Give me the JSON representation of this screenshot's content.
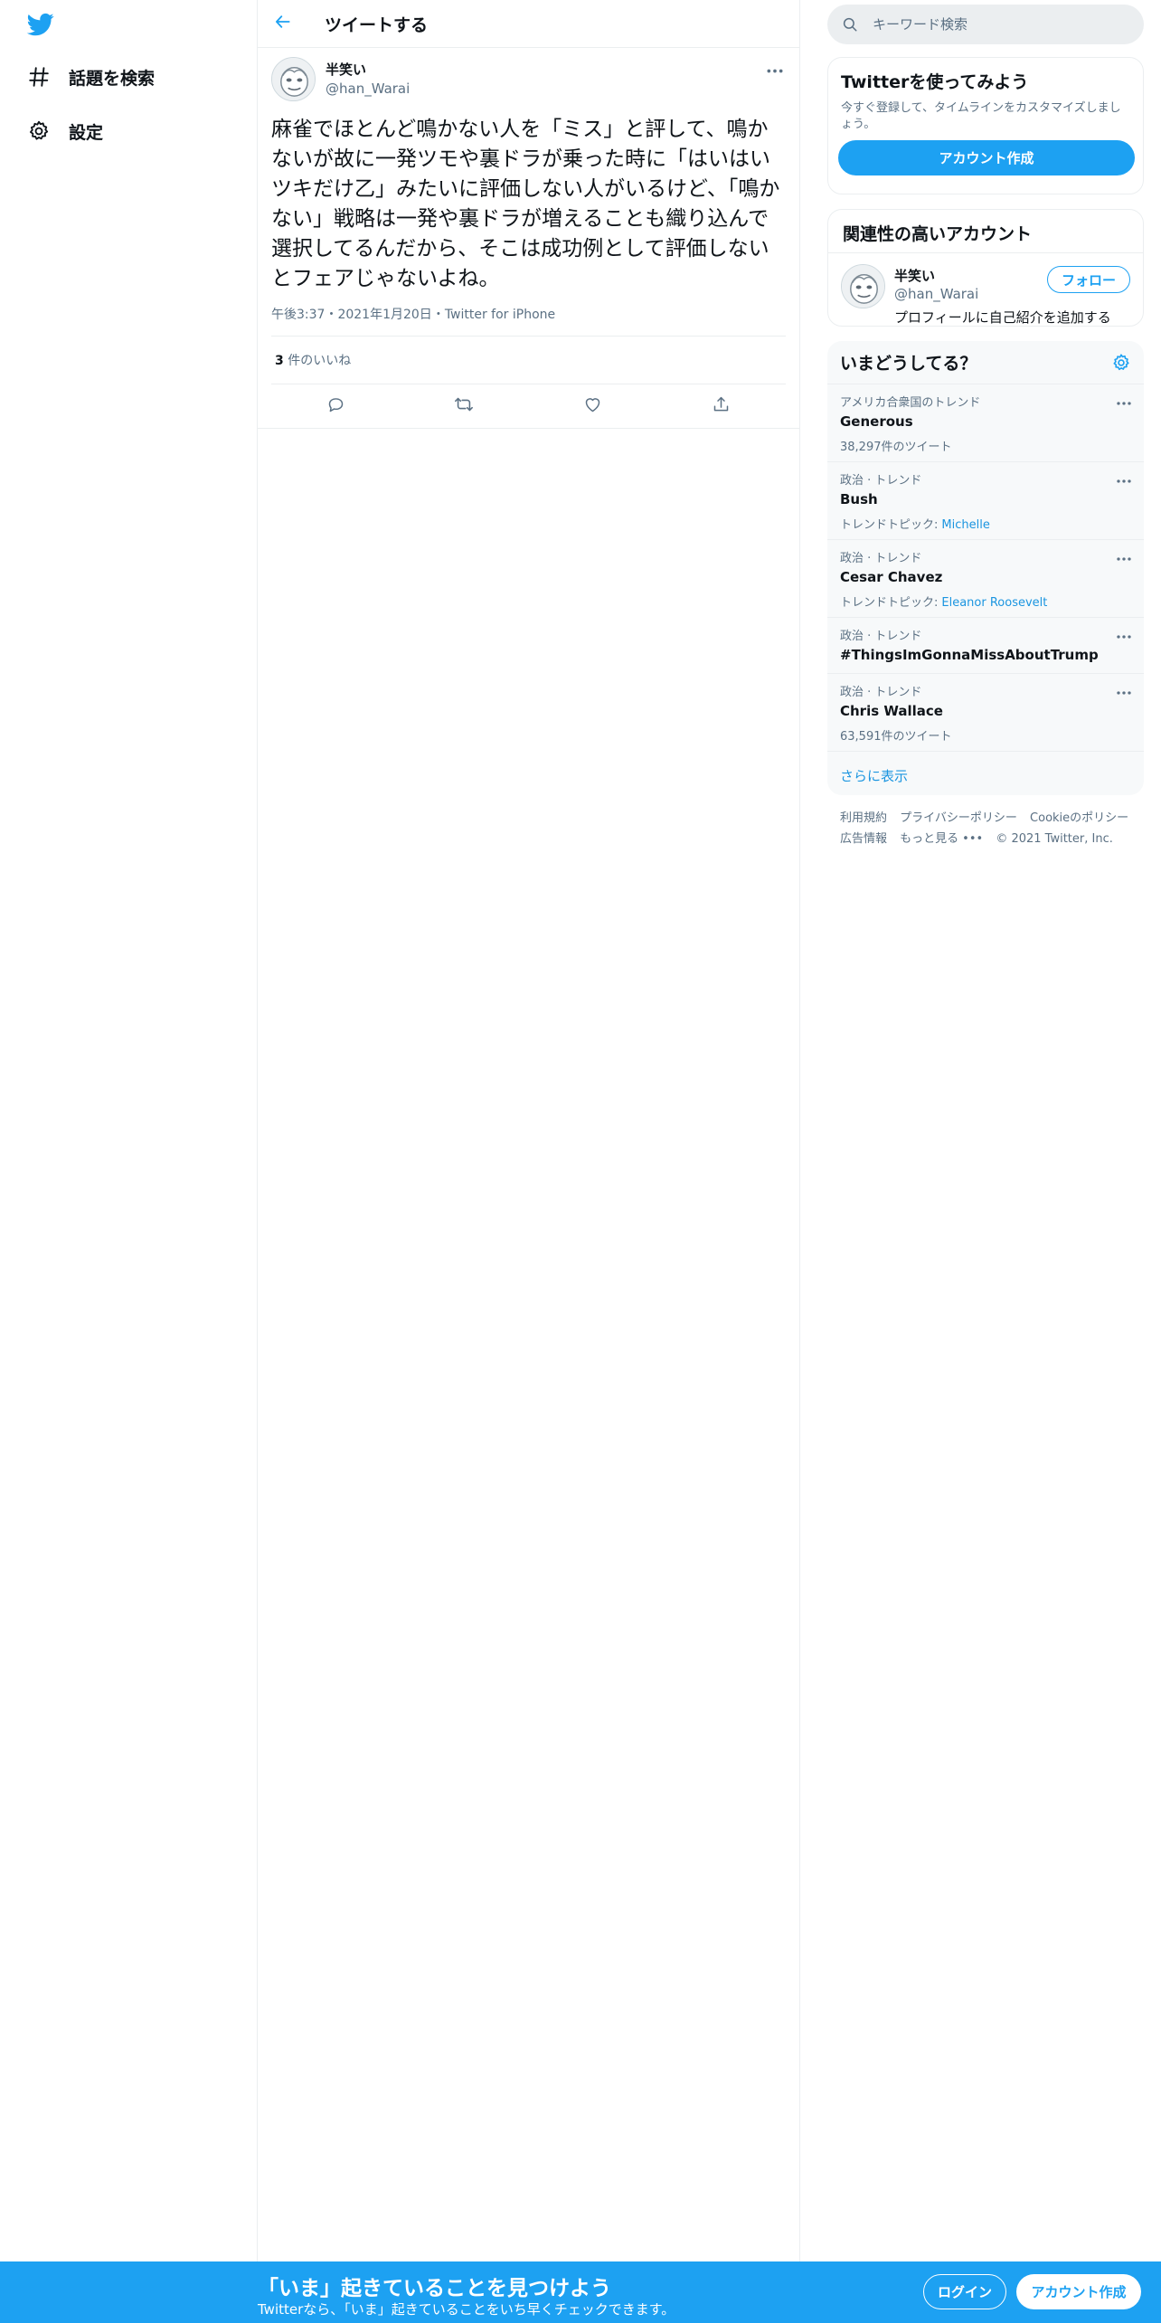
{
  "nav": {
    "logo": "twitter-bird-icon",
    "items": [
      {
        "label": "話題を検索",
        "icon": "hashtag-icon"
      },
      {
        "label": "設定",
        "icon": "gear-icon"
      }
    ]
  },
  "header": {
    "title": "ツイートする",
    "back_icon": "back-arrow-icon"
  },
  "tweet": {
    "author_name": "半笑い",
    "author_handle": "@han_Warai",
    "text": "麻雀でほとんど鳴かない人を「ミス」と評して、鳴かないが故に一発ツモや裏ドラが乗った時に「はいはいツキだけ乙」みたいに評価しない人がいるけど、「鳴かない」戦略は一発や裏ドラが増えることも織り込んで選択してるんだから、そこは成功例として評価しないとフェアじゃないよね。",
    "time": "午後3:37",
    "separator": "・",
    "date": "2021年1月20日",
    "source": "Twitter for iPhone",
    "like_count": "3",
    "like_label": " 件のいいね"
  },
  "search": {
    "placeholder": "キーワード検索"
  },
  "signup_card": {
    "title": "Twitterを使ってみよう",
    "subtitle": "今すぐ登録して、タイムラインをカスタマイズしましょう。",
    "button": "アカウント作成"
  },
  "related": {
    "title": "関連性の高いアカウント",
    "name": "半笑い",
    "handle": "@han_Warai",
    "bio": "プロフィールに自己紹介を追加する",
    "follow": "フォロー"
  },
  "trends": {
    "title": "いまどうしてる？",
    "items": [
      {
        "context": "アメリカ合衆国のトレンド",
        "name": "Generous",
        "meta": "38,297件のツイート",
        "link": ""
      },
      {
        "context": "政治 · トレンド",
        "name": "Bush",
        "meta": "トレンドトピック:",
        "link": "Michelle"
      },
      {
        "context": "政治 · トレンド",
        "name": "Cesar Chavez",
        "meta": "トレンドトピック:",
        "link": "Eleanor Roosevelt"
      },
      {
        "context": "政治 · トレンド",
        "name": "#ThingsImGonnaMissAboutTrump",
        "meta": "",
        "link": ""
      },
      {
        "context": "政治 · トレンド",
        "name": "Chris Wallace",
        "meta": "63,591件のツイート",
        "link": ""
      }
    ],
    "show_more": "さらに表示"
  },
  "footer": {
    "terms": "利用規約",
    "privacy": "プライバシーポリシー",
    "cookie": "Cookieのポリシー",
    "ads": "広告情報",
    "more": "もっと見る",
    "copyright": "© 2021 Twitter, Inc."
  },
  "bottom_bar": {
    "title": "「いま」起きていることを見つけよう",
    "subtitle": "Twitterなら、「いま」起きていることをいち早くチェックできます。",
    "login": "ログイン",
    "signup": "アカウント作成"
  },
  "colors": {
    "brand": "#1da1f2",
    "link": "#1b95e0",
    "muted": "#5b7083",
    "text": "#0f1419",
    "border": "#ebeef0"
  }
}
